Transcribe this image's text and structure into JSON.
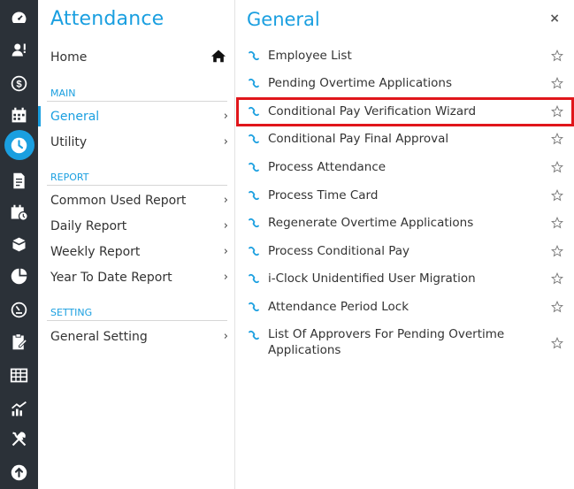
{
  "rail": {
    "icons": [
      "dashboard-icon",
      "user-alert-icon",
      "dollar-icon",
      "calendar-icon",
      "clock-icon",
      "document-icon",
      "calendar-clock-icon",
      "box-icon",
      "chart-pie-icon",
      "gauge-icon",
      "clipboard-edit-icon",
      "grid-calendar-icon",
      "trending-chart-icon",
      "tools-icon",
      "upload-icon"
    ],
    "active_index": 4,
    "active_color": "#1a9fe0"
  },
  "menu": {
    "title": "Attendance",
    "home": "Home",
    "sections": [
      {
        "label": "MAIN",
        "items": [
          "General",
          "Utility"
        ]
      },
      {
        "label": "REPORT",
        "items": [
          "Common Used Report",
          "Daily Report",
          "Weekly Report",
          "Year To Date Report"
        ]
      },
      {
        "label": "SETTING",
        "items": [
          "General Setting"
        ]
      }
    ],
    "active_item": "General"
  },
  "list": {
    "title": "General",
    "close_label": "×",
    "items": [
      "Employee List",
      "Pending Overtime Applications",
      "Conditional Pay Verification Wizard",
      "Conditional Pay Final Approval",
      "Process Attendance",
      "Process Time Card",
      "Regenerate Overtime Applications",
      "Process Conditional Pay",
      "i-Clock Unidentified User Migration",
      "Attendance Period Lock",
      "List Of Approvers For Pending Overtime",
      "Applications"
    ],
    "highlighted_item": "Conditional Pay Verification Wizard",
    "highlight_color": "#e0161b"
  }
}
